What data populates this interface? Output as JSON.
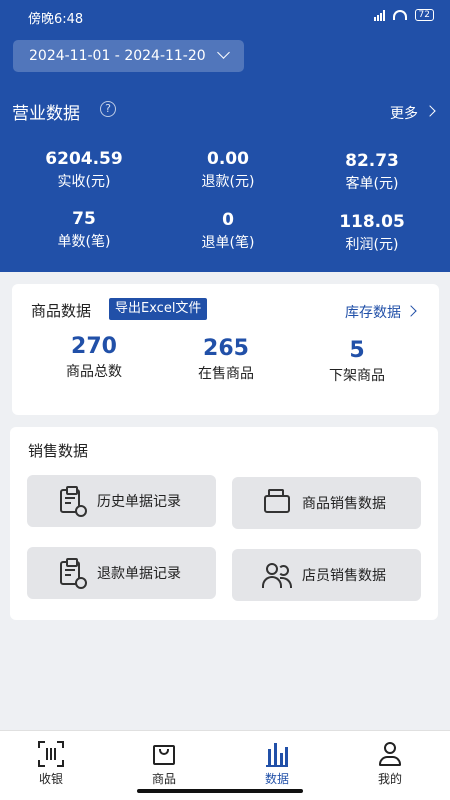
{
  "status": {
    "time": "傍晚6:48",
    "battery": "72"
  },
  "header": {
    "date_range": "2024-11-01 - 2024-11-20",
    "business_title": "营业数据",
    "more_label": "更多",
    "metrics": [
      {
        "value": "6204.59",
        "label": "实收(元)"
      },
      {
        "value": "0.00",
        "label": "退款(元)"
      },
      {
        "value": "82.73",
        "label": "客单(元)"
      },
      {
        "value": "75",
        "label": "单数(笔)"
      },
      {
        "value": "0",
        "label": "退单(笔)"
      },
      {
        "value": "118.05",
        "label": "利润(元)"
      }
    ]
  },
  "goods": {
    "title": "商品数据",
    "export_label": "导出Excel文件",
    "stock_label": "库存数据",
    "stats": [
      {
        "value": "270",
        "label": "商品总数"
      },
      {
        "value": "265",
        "label": "在售商品"
      },
      {
        "value": "5",
        "label": "下架商品"
      }
    ]
  },
  "sales": {
    "title": "销售数据",
    "buttons": [
      {
        "label": "历史单据记录",
        "icon": "clipboard-clock-icon"
      },
      {
        "label": "商品销售数据",
        "icon": "box-icon"
      },
      {
        "label": "退款单据记录",
        "icon": "clipboard-refund-icon"
      },
      {
        "label": "店员销售数据",
        "icon": "users-icon"
      }
    ]
  },
  "tabs": [
    {
      "label": "收银",
      "icon": "scan-icon"
    },
    {
      "label": "商品",
      "icon": "bag-icon"
    },
    {
      "label": "数据",
      "icon": "bar-chart-icon"
    },
    {
      "label": "我的",
      "icon": "user-icon"
    }
  ],
  "colors": {
    "primary": "#2150a8",
    "background": "#eef0f3"
  }
}
